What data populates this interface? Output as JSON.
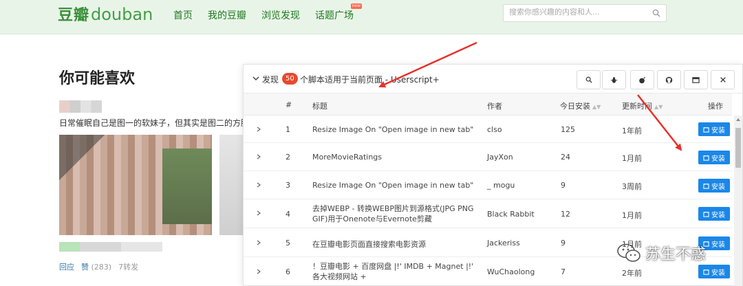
{
  "header": {
    "logo_cn": "豆瓣",
    "logo_en": "douban",
    "nav": [
      "首页",
      "我的豆瓣",
      "浏览发现",
      "话题广场"
    ],
    "new_badge": "new",
    "search_placeholder": "搜索你感兴趣的内容和人..."
  },
  "feed": {
    "heading": "你可能喜欢",
    "description": "日常催眠自己是图一的软妹子，但其实是图二的方脸阿",
    "actions": {
      "reply": "回应",
      "like": "赞",
      "like_count": "(283)",
      "repost": "7转发"
    }
  },
  "panel": {
    "found_prefix": "发现",
    "count": "50",
    "found_suffix": "个脚本适用于当前页面 - Userscript+",
    "tool_icons": [
      "search-icon",
      "bug-icon",
      "bomb-icon",
      "github-icon",
      "window-icon",
      "close-icon"
    ],
    "columns": {
      "index": "#",
      "title": "标题",
      "author": "作者",
      "today": "今日安装",
      "updated": "更新时间",
      "ops": "操作"
    },
    "install_label": "安装",
    "rows": [
      {
        "index": "1",
        "title": "Resize Image On \"Open image in new tab\"",
        "author": "clso",
        "today": "125",
        "updated": "1年前"
      },
      {
        "index": "2",
        "title": "MoreMovieRatings",
        "author": "JayXon",
        "today": "24",
        "updated": "1月前"
      },
      {
        "index": "3",
        "title": "Resize Image On \"Open image in new tab\"",
        "author": "_ mogu",
        "today": "9",
        "updated": "3周前"
      },
      {
        "index": "4",
        "title": "去掉WEBP - 转换WEBP图片到源格式(JPG PNG GIF)用于Onenote与Evernote剪藏",
        "author": "Black Rabbit",
        "today": "12",
        "updated": "1月前"
      },
      {
        "index": "5",
        "title": "在豆瓣电影页面直接搜索电影资源",
        "author": "Jackeriss",
        "today": "9",
        "updated": "1月前"
      },
      {
        "index": "6",
        "title": "！豆瓣电影 + 百度网盘 |!' IMDB + Magnet |!' 各大视频网站 +",
        "author": "WuChaolong",
        "today": "7",
        "updated": "2年前"
      }
    ]
  },
  "watermark": {
    "text": "苏生不惑"
  },
  "colors": {
    "accent_green": "#3a8f3a",
    "install_blue": "#1a87e8",
    "badge_red": "#e8492e",
    "arrow_red": "#e8302a"
  }
}
